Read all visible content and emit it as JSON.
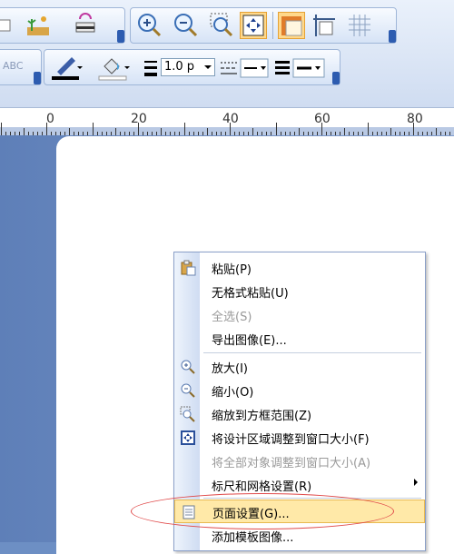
{
  "toolbar": {
    "line_width_value": "1.0 p",
    "icons": [
      "shape-icon",
      "image-icon",
      "paste-object-icon",
      "zoom-in-icon",
      "zoom-out-icon",
      "zoom-box-icon",
      "fit-window-icon",
      "ruler-icon",
      "page-icon",
      "grid-icon",
      "pen-color-icon",
      "fill-color-icon",
      "line-width-icon",
      "dash-style-icon",
      "line-style-icon"
    ]
  },
  "ruler": {
    "labels": [
      "0",
      "20",
      "40",
      "60",
      "80"
    ]
  },
  "context_menu": {
    "items": [
      {
        "label": "粘贴(P)",
        "disabled": false,
        "icon": "paste-icon"
      },
      {
        "label": "无格式粘贴(U)",
        "disabled": false,
        "icon": ""
      },
      {
        "label": "全选(S)",
        "disabled": true,
        "icon": ""
      },
      {
        "label": "导出图像(E)...",
        "disabled": false,
        "icon": ""
      },
      {
        "label": "放大(I)",
        "disabled": false,
        "icon": "zoom-in-icon"
      },
      {
        "label": "缩小(O)",
        "disabled": false,
        "icon": "zoom-out-icon"
      },
      {
        "label": "缩放到方框范围(Z)",
        "disabled": false,
        "icon": "zoom-box-icon"
      },
      {
        "label": "将设计区域调整到窗口大小(F)",
        "disabled": false,
        "icon": "fit-window-icon"
      },
      {
        "label": "将全部对象调整到窗口大小(A)",
        "disabled": true,
        "icon": ""
      },
      {
        "label": "标尺和网格设置(R)",
        "disabled": false,
        "icon": "",
        "submenu": true
      },
      {
        "label": "页面设置(G)...",
        "disabled": false,
        "icon": "page-setup-icon",
        "highlighted": true
      },
      {
        "label": "添加模板图像...",
        "disabled": false,
        "icon": ""
      }
    ]
  },
  "colors": {
    "accent": "#ffd88a",
    "annotation_ellipse": "#e04a4a"
  }
}
